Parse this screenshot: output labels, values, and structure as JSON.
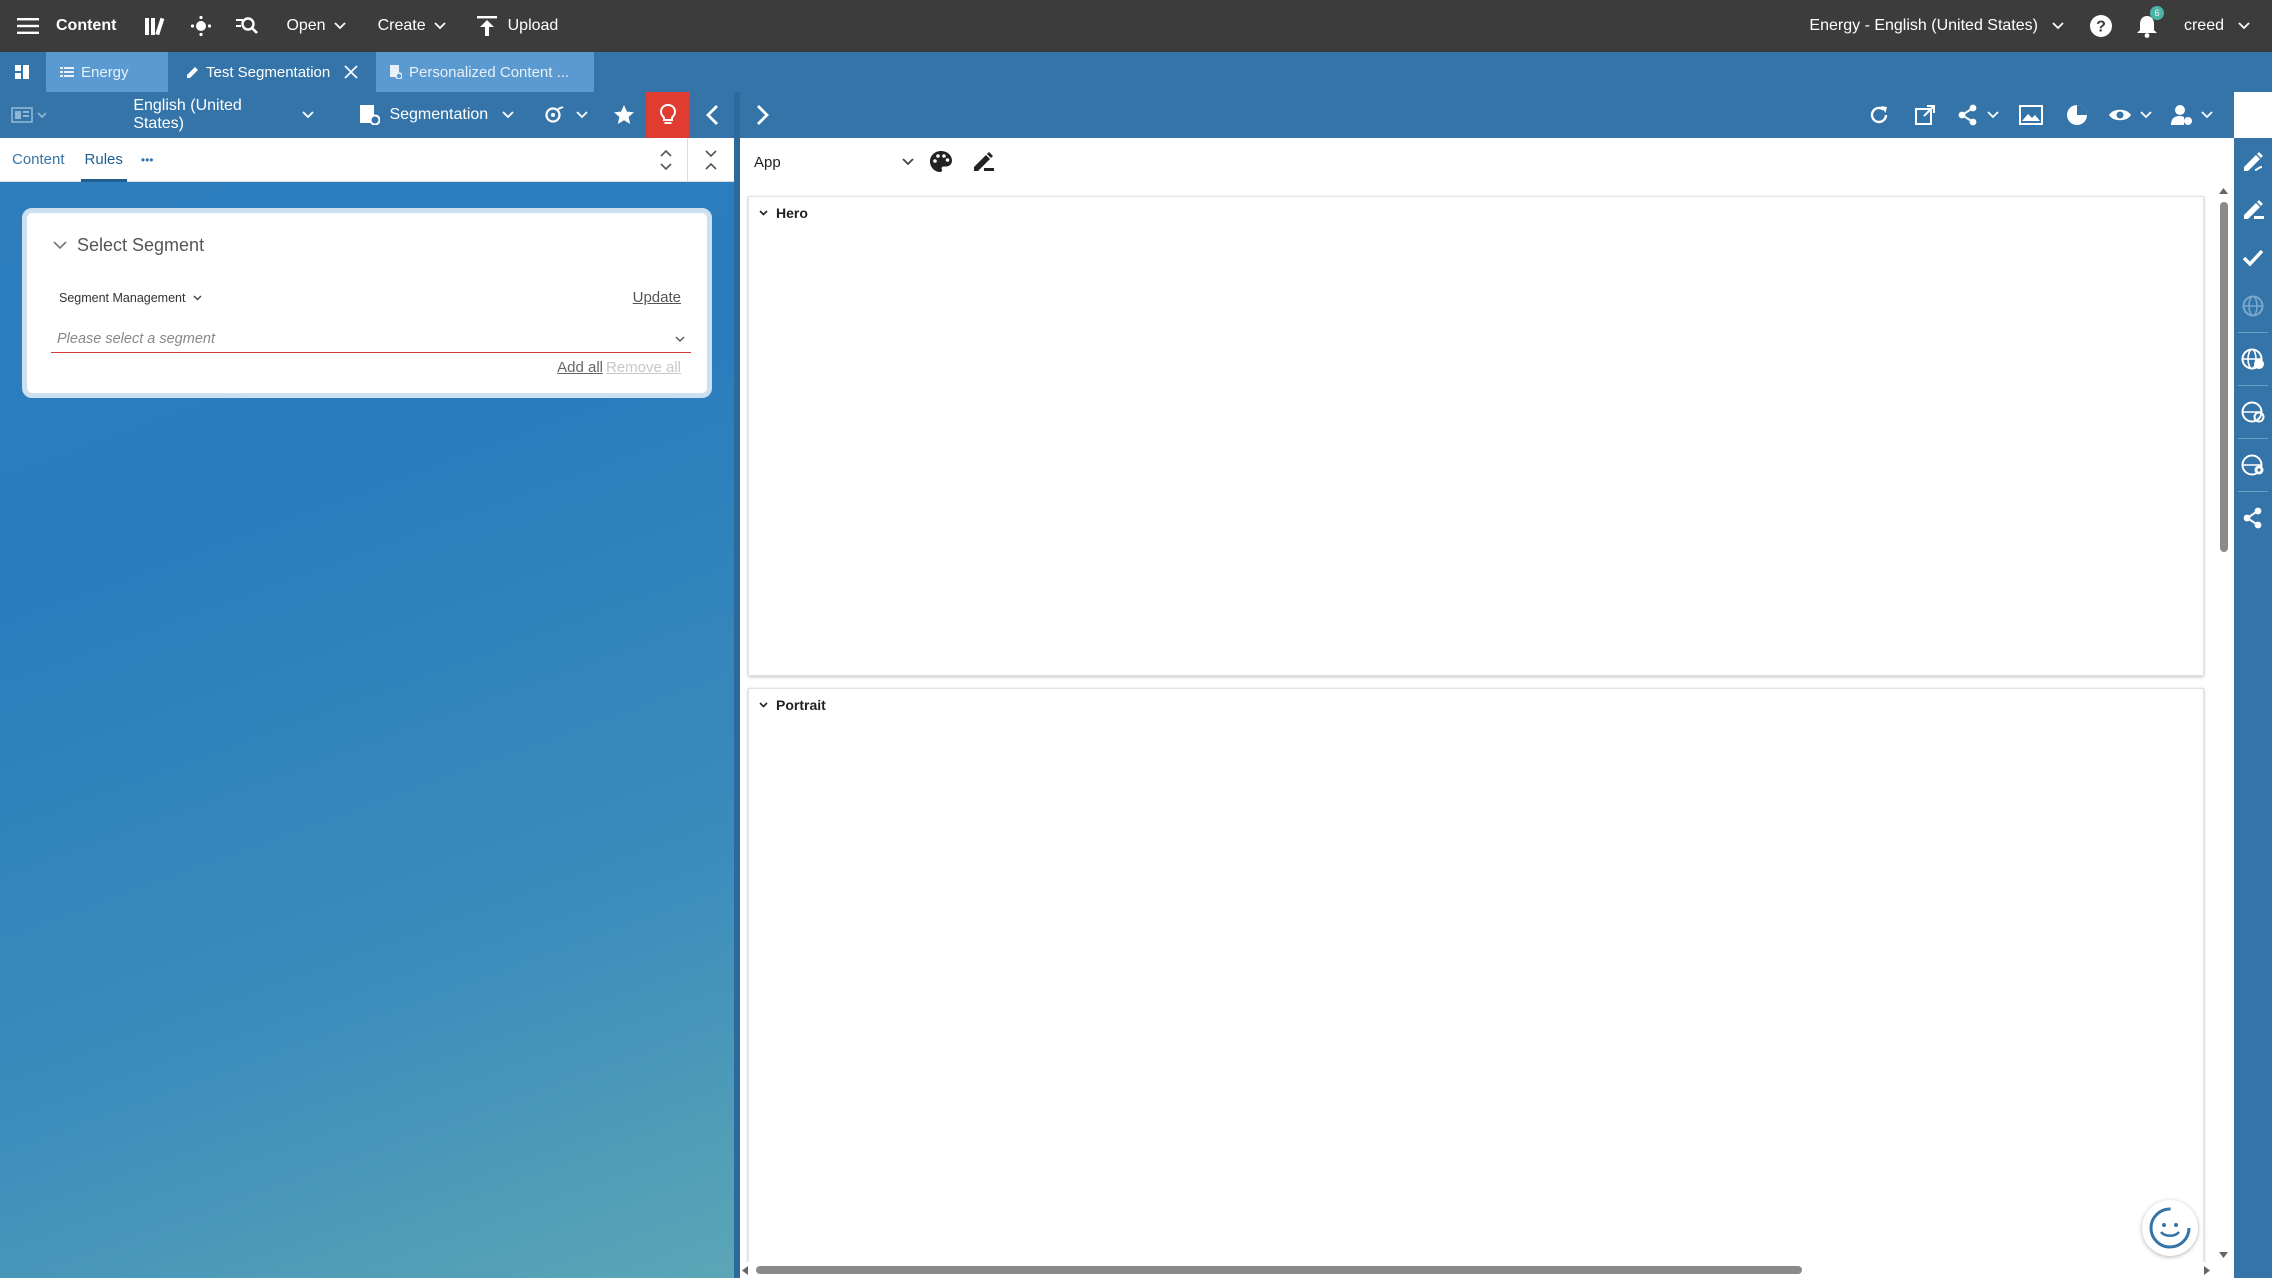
{
  "topbar": {
    "app_label": "Content",
    "open_label": "Open",
    "create_label": "Create",
    "upload_label": "Upload",
    "site_label": "Energy - English (United States)",
    "notifications_count": "6",
    "user_label": "creed"
  },
  "tabs": [
    {
      "label": "Energy"
    },
    {
      "label": "Test Segmentation"
    },
    {
      "label": "Personalized Content ..."
    }
  ],
  "left_toolbar": {
    "locale_label": "English (United States)",
    "segmentation_label": "Segmentation"
  },
  "left_tabs": {
    "content_label": "Content",
    "rules_label": "Rules",
    "more_label": "•••"
  },
  "segment_card": {
    "title": "Select Segment",
    "management_label": "Segment Management",
    "update_label": "Update",
    "placeholder": "Please select a segment",
    "add_all_label": "Add all",
    "remove_all_label": "Remove all"
  },
  "preview": {
    "app_select_value": "App",
    "sections": [
      {
        "label": "Hero"
      },
      {
        "label": "Portrait"
      }
    ]
  },
  "colors": {
    "topbar": "#3c3c3c",
    "primary": "#3474a8",
    "accent_red": "#e03c31",
    "error_line": "#d63a3a"
  },
  "icons": {
    "menu": "hamburger-icon",
    "library": "library-icon",
    "workflow": "workflow-icon",
    "search": "search-icon",
    "upload": "upload-icon",
    "help": "help-icon",
    "notifications": "bell-icon",
    "favorite": "star-icon",
    "ideas": "lightbulb-icon"
  }
}
